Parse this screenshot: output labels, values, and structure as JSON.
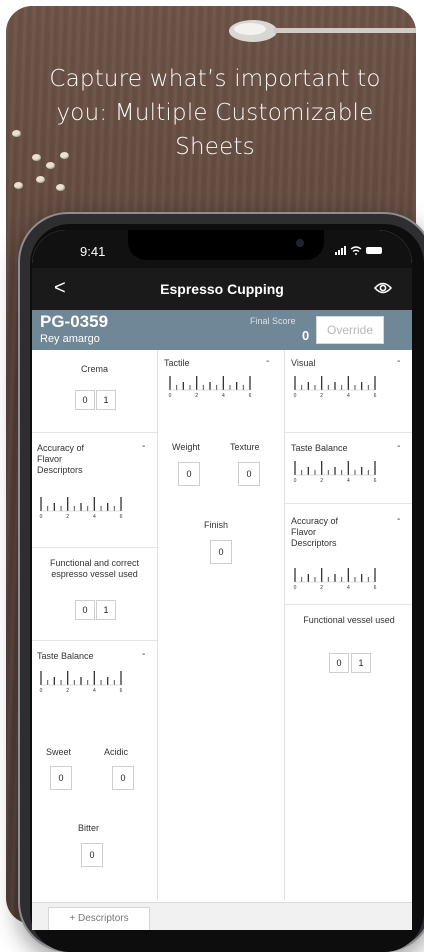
{
  "headline": "Capture what’s important to you: Multiple Customizable Sheets",
  "status": {
    "time": "9:41"
  },
  "nav": {
    "back": "<",
    "title": "Espresso Cupping",
    "eye_icon": "eye-icon"
  },
  "sheet_header": {
    "code": "PG-0359",
    "name": "Rey amargo",
    "final_score_label": "Final Score",
    "final_score_value": "0",
    "override_label": "Override"
  },
  "scale_ticks": [
    "0",
    "2",
    "4",
    "6"
  ],
  "columns": [
    {
      "cards": [
        {
          "type": "toggle",
          "title": "Crema",
          "buttons": [
            "0",
            "1"
          ]
        },
        {
          "type": "scale",
          "title": "Accuracy of Flavor Descriptors",
          "minus": "-"
        },
        {
          "type": "toggle",
          "title": "Functional and correct espresso vessel used",
          "buttons": [
            "0",
            "1"
          ]
        },
        {
          "type": "scale",
          "title": "Taste Balance",
          "minus": "-",
          "counters": [
            {
              "label": "Sweet",
              "value": "0"
            },
            {
              "label": "Acidic",
              "value": "0"
            },
            {
              "label": "Bitter",
              "value": "0"
            }
          ]
        }
      ]
    },
    {
      "cards": [
        {
          "type": "scale",
          "title": "Tactile",
          "minus": "-",
          "counters": [
            {
              "label": "Weight",
              "value": "0"
            },
            {
              "label": "Texture",
              "value": "0"
            },
            {
              "label": "Finish",
              "value": "0"
            }
          ]
        }
      ]
    },
    {
      "cards": [
        {
          "type": "scale",
          "title": "Visual",
          "minus": "-"
        },
        {
          "type": "scale",
          "title": "Taste Balance",
          "minus": "-"
        },
        {
          "type": "scale",
          "title": "Accuracy of Flavor Descriptors",
          "minus": "-"
        },
        {
          "type": "toggle",
          "title": "Functional vessel used",
          "buttons": [
            "0",
            "1"
          ]
        }
      ]
    }
  ],
  "footer": {
    "descriptors_label": "Descriptors"
  },
  "colors": {
    "header_bar": "#6f8797",
    "nav_bar": "#1a1a1a"
  }
}
